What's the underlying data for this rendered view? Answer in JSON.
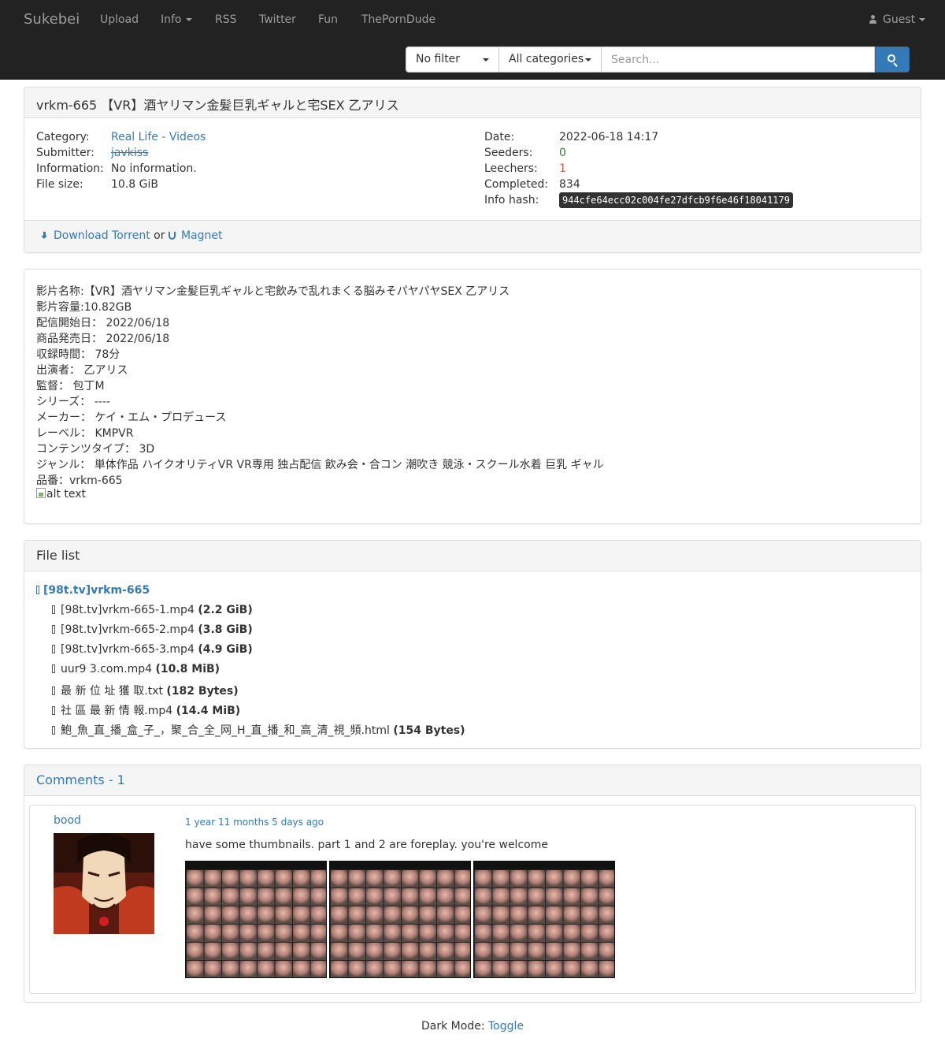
{
  "navbar": {
    "brand": "Sukebei",
    "links": {
      "upload": "Upload",
      "info": "Info",
      "rss": "RSS",
      "twitter": "Twitter",
      "fun": "Fun",
      "tpd": "ThePornDude"
    },
    "user_label": "Guest"
  },
  "search": {
    "filter_value": "No filter",
    "category_value": "All categories",
    "placeholder": "Search..."
  },
  "torrent": {
    "title": "vrkm-665 【VR】酒ヤリマン金髪巨乳ギャルと宅SEX 乙アリス",
    "labels": {
      "category": "Category:",
      "submitter": "Submitter:",
      "information": "Information:",
      "file_size": "File size:",
      "date": "Date:",
      "seeders": "Seeders:",
      "leechers": "Leechers:",
      "completed": "Completed:",
      "info_hash": "Info hash:"
    },
    "category_main": "Real Life",
    "category_sep": " - ",
    "category_sub": "Videos",
    "submitter": "javkiss",
    "information": "No information.",
    "file_size": "10.8 GiB",
    "date": "2022-06-18 14:17",
    "seeders": "0",
    "leechers": "1",
    "completed": "834",
    "info_hash": "944cfe64ecc02c004fe27dfcb9f6e46f18041179",
    "download_label": "Download Torrent",
    "or_text": " or ",
    "magnet_label": "Magnet"
  },
  "description": {
    "lines": [
      "影片名称:【VR】酒ヤリマン金髪巨乳ギャルと宅飲みで乱れまくる脳みそパヤパヤSEX 乙アリス",
      "影片容量:10.82GB",
      "配信開始日： 2022/06/18",
      "商品発売日： 2022/06/18",
      "収録時間： 78分",
      "出演者： 乙アリス",
      "監督： 包丁M",
      "シリーズ： ----",
      "メーカー： ケイ・エム・プロデュース",
      "レーベル： KMPVR",
      "コンテンツタイプ： 3D",
      "ジャンル： 単体作品 ハイクオリティVR VR専用 独占配信 飲み会・合コン 潮吹き 競泳・スクール水着 巨乳 ギャル",
      "品番：vrkm-665"
    ],
    "image_alt": "alt text"
  },
  "file_list": {
    "heading": "File list",
    "folder": "[98t.tv]vrkm-665",
    "files": [
      {
        "name": "[98t.tv]vrkm-665-1.mp4",
        "size": "(2.2 GiB)"
      },
      {
        "name": "[98t.tv]vrkm-665-2.mp4",
        "size": "(3.8 GiB)"
      },
      {
        "name": "[98t.tv]vrkm-665-3.mp4",
        "size": "(4.9 GiB)"
      },
      {
        "name": "uur9 3.com.mp4",
        "size": "(10.8 MiB)"
      },
      {
        "name": "最 新 位 址 獲 取.txt",
        "size": "(182 Bytes)"
      },
      {
        "name": "社 區 最 新 情 報.mp4",
        "size": "(14.4 MiB)"
      },
      {
        "name": "鮑_魚_直_播_盒_子_，聚_合_全_网_H_直_播_和_高_清_視_頻.html",
        "size": "(154 Bytes)"
      }
    ]
  },
  "comments": {
    "heading": "Comments - 1",
    "items": [
      {
        "user": "bood",
        "date": "1 year 11 months 5 days ago",
        "text": "have some thumbnails. part 1 and 2 are foreplay. you're welcome",
        "thumbnail_count": 3
      }
    ]
  },
  "footer": {
    "dark_mode_label": "Dark Mode: ",
    "toggle_label": "Toggle"
  },
  "colors": {
    "navbar_bg": "#222222",
    "link": "#337ab7",
    "seeders": "#3c763d",
    "leechers": "#d9534f",
    "panel_heading_bg": "#f5f5f5"
  }
}
